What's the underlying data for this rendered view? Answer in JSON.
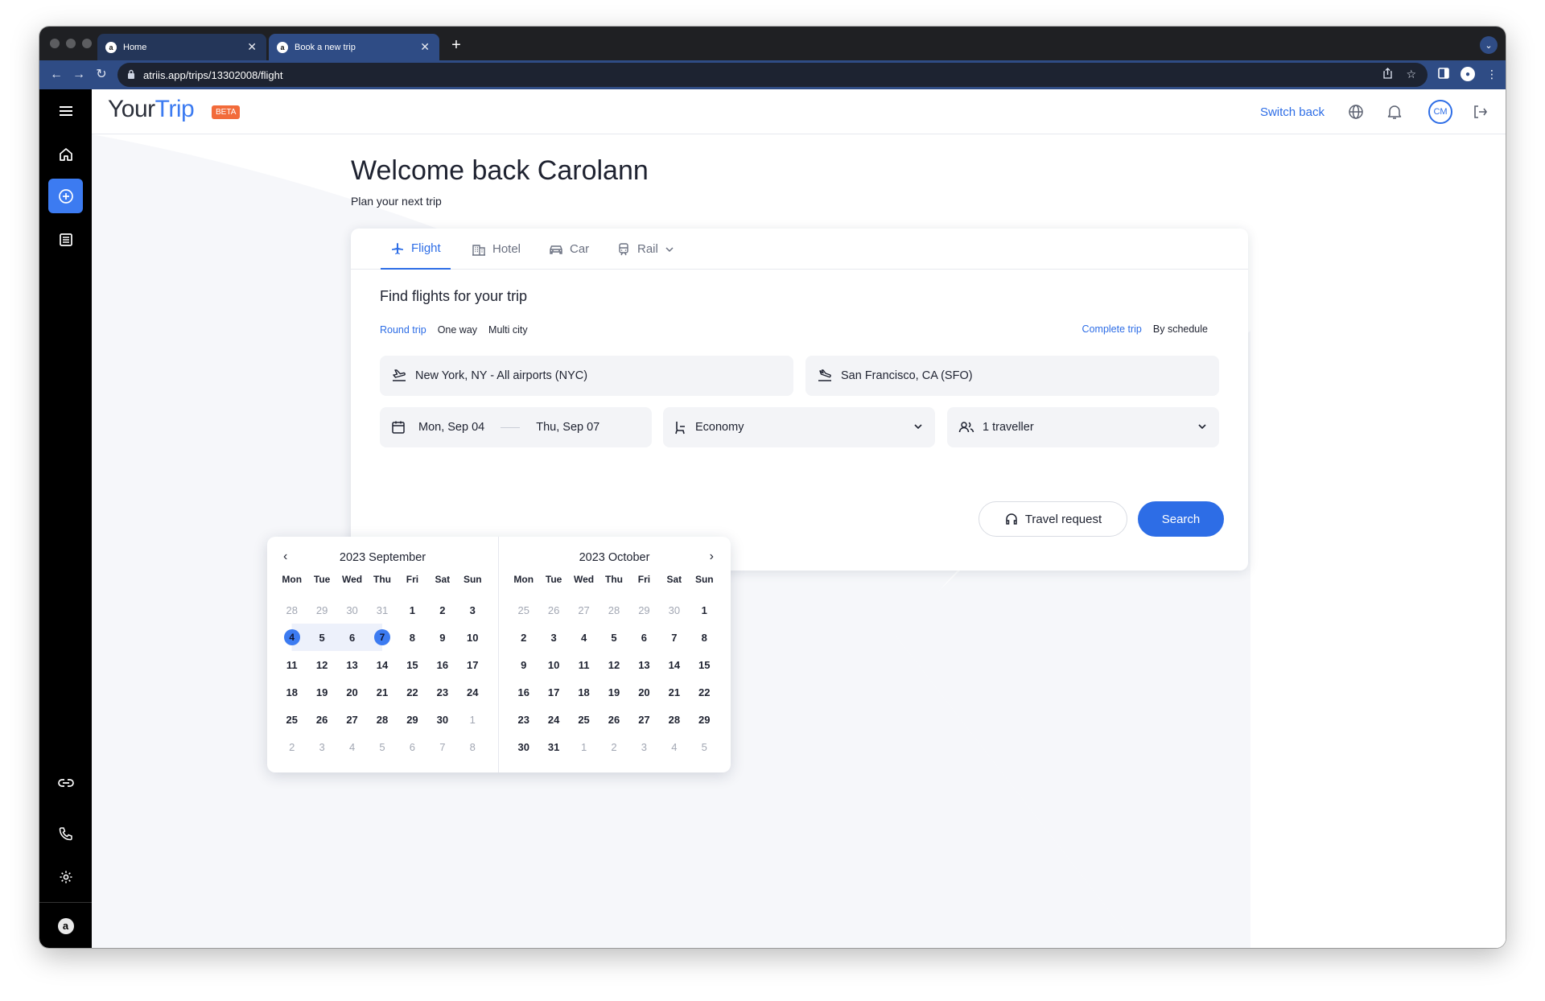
{
  "browser": {
    "tabs": [
      {
        "label": "Home",
        "favicon": "a"
      },
      {
        "label": "Book a new trip",
        "favicon": "a"
      }
    ],
    "url": "atriis.app/trips/13302008/flight"
  },
  "header": {
    "logo_your": "Your",
    "logo_trip": "Trip",
    "beta": "BETA",
    "switch_back": "Switch back",
    "avatar_initials": "CM"
  },
  "sidebar": {
    "footer_logo": "a",
    "items": [
      "menu-icon",
      "home-icon",
      "add-trip-icon",
      "trips-list-icon",
      "link-icon",
      "phone-icon",
      "settings-icon"
    ]
  },
  "main": {
    "welcome": "Welcome back Carolann",
    "subtitle": "Plan your next trip"
  },
  "booking": {
    "tabs": [
      {
        "label": "Flight",
        "icon": "plane-icon"
      },
      {
        "label": "Hotel",
        "icon": "hotel-icon"
      },
      {
        "label": "Car",
        "icon": "car-icon"
      },
      {
        "label": "Rail",
        "icon": "rail-icon"
      }
    ],
    "title": "Find flights for your trip",
    "trip_types": [
      "Round trip",
      "One way",
      "Multi city"
    ],
    "modes": [
      "Complete trip",
      "By schedule"
    ],
    "origin": "New York, NY - All airports (NYC)",
    "destination": "San Francisco, CA (SFO)",
    "depart_date": "Mon, Sep 04",
    "return_date": "Thu, Sep 07",
    "cabin": "Economy",
    "travellers": "1 traveller",
    "travel_request": "Travel request",
    "search": "Search"
  },
  "calendar": {
    "weekdays": [
      "Mon",
      "Tue",
      "Wed",
      "Thu",
      "Fri",
      "Sat",
      "Sun"
    ],
    "months": [
      {
        "title": "2023 September",
        "weeks": [
          [
            "28",
            "29",
            "30",
            "31",
            "1",
            "2",
            "3"
          ],
          [
            "4",
            "5",
            "6",
            "7",
            "8",
            "9",
            "10"
          ],
          [
            "11",
            "12",
            "13",
            "14",
            "15",
            "16",
            "17"
          ],
          [
            "18",
            "19",
            "20",
            "21",
            "22",
            "23",
            "24"
          ],
          [
            "25",
            "26",
            "27",
            "28",
            "29",
            "30",
            "1"
          ],
          [
            "2",
            "3",
            "4",
            "5",
            "6",
            "7",
            "8"
          ]
        ],
        "first_in_month": 4,
        "last_in_month": 33
      },
      {
        "title": "2023 October",
        "weeks": [
          [
            "25",
            "26",
            "27",
            "28",
            "29",
            "30",
            "1"
          ],
          [
            "2",
            "3",
            "4",
            "5",
            "6",
            "7",
            "8"
          ],
          [
            "9",
            "10",
            "11",
            "12",
            "13",
            "14",
            "15"
          ],
          [
            "16",
            "17",
            "18",
            "19",
            "20",
            "21",
            "22"
          ],
          [
            "23",
            "24",
            "25",
            "26",
            "27",
            "28",
            "29"
          ],
          [
            "30",
            "31",
            "1",
            "2",
            "3",
            "4",
            "5"
          ]
        ],
        "first_in_month": 6,
        "last_in_month": 36
      }
    ],
    "range_start": "4",
    "range_end": "7",
    "range_month": 0
  },
  "colors": {
    "accent": "#2d6de6",
    "beta": "#f26b3a",
    "sidebar": "#000000"
  }
}
